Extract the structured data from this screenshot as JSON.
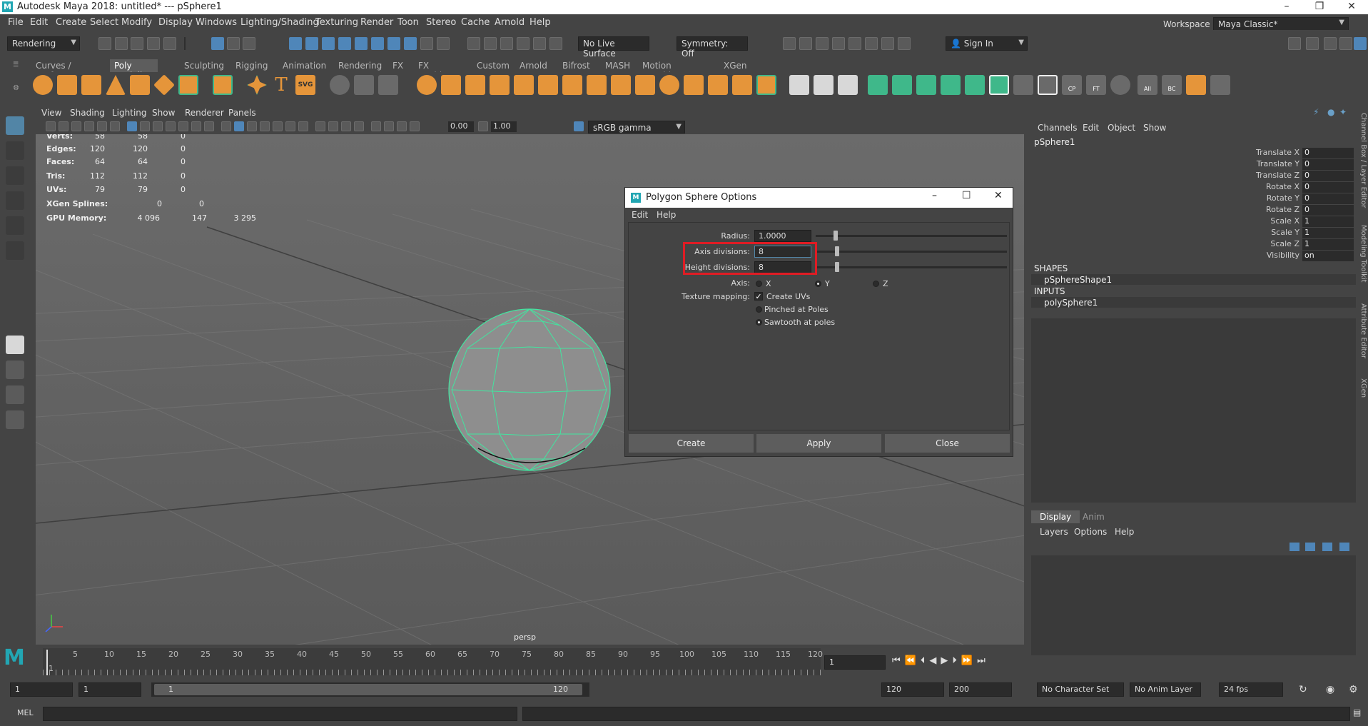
{
  "window": {
    "title": "Autodesk Maya 2018: untitled*   ---   pSphere1",
    "minimize": "–",
    "restore": "❐",
    "close": "✕"
  },
  "menubar": {
    "items": [
      "File",
      "Edit",
      "Create",
      "Select",
      "Modify",
      "Display",
      "Windows",
      "Lighting/Shading",
      "Texturing",
      "Render",
      "Toon",
      "Stereo",
      "Cache",
      "Arnold",
      "Help"
    ],
    "workspace_label": "Workspace :",
    "workspace_value": "Maya Classic*"
  },
  "statusline": {
    "menuset": "Rendering",
    "live_surface": "No Live Surface",
    "symmetry": "Symmetry: Off",
    "sign_in": "Sign In"
  },
  "shelf": {
    "tabs": [
      "Curves / Surfaces",
      "Poly Modeling",
      "Sculpting",
      "Rigging",
      "Animation",
      "Rendering",
      "FX",
      "FX Caching",
      "Custom",
      "Arnold",
      "Bifrost",
      "MASH",
      "Motion Graphics",
      "XGen"
    ],
    "active_tab": "Poly Modeling",
    "icon_labels": {
      "cp": "CP",
      "ft": "FT",
      "all": "All",
      "bc": "BC",
      "text": "T",
      "svg": "SVG"
    }
  },
  "viewport": {
    "menu": [
      "View",
      "Shading",
      "Lighting",
      "Show",
      "Renderer",
      "Panels"
    ],
    "exposure": "0.00",
    "gamma_value": "1.00",
    "color_space": "sRGB gamma",
    "camera": "persp",
    "hud": [
      {
        "label": "Verts:",
        "v1": "58",
        "v2": "58",
        "v3": "0"
      },
      {
        "label": "Edges:",
        "v1": "120",
        "v2": "120",
        "v3": "0"
      },
      {
        "label": "Faces:",
        "v1": "64",
        "v2": "64",
        "v3": "0"
      },
      {
        "label": "Tris:",
        "v1": "112",
        "v2": "112",
        "v3": "0"
      },
      {
        "label": "UVs:",
        "v1": "79",
        "v2": "79",
        "v3": "0"
      },
      {
        "label": "XGen Splines:",
        "v1": "0",
        "v2": "0",
        "v3": ""
      },
      {
        "label": "GPU Memory:",
        "v1": "4 096",
        "v2": "147",
        "v3": "3 295"
      }
    ]
  },
  "dialog": {
    "title": "Polygon Sphere Options",
    "menu": [
      "Edit",
      "Help"
    ],
    "radius_label": "Radius:",
    "radius_value": "1.0000",
    "axis_div_label": "Axis divisions:",
    "axis_div_value": "8",
    "height_div_label": "Height divisions:",
    "height_div_value": "8",
    "axis_label": "Axis:",
    "axis_options": [
      "X",
      "Y",
      "Z"
    ],
    "axis_selected": "Y",
    "texture_label": "Texture mapping:",
    "create_uvs": "Create UVs",
    "pinched": "Pinched at Poles",
    "sawtooth": "Sawtooth at poles",
    "buttons": [
      "Create",
      "Apply",
      "Close"
    ]
  },
  "channel_box": {
    "menu": [
      "Channels",
      "Edit",
      "Object",
      "Show"
    ],
    "object": "pSphere1",
    "attributes": [
      {
        "name": "Translate X",
        "value": "0"
      },
      {
        "name": "Translate Y",
        "value": "0"
      },
      {
        "name": "Translate Z",
        "value": "0"
      },
      {
        "name": "Rotate X",
        "value": "0"
      },
      {
        "name": "Rotate Y",
        "value": "0"
      },
      {
        "name": "Rotate Z",
        "value": "0"
      },
      {
        "name": "Scale X",
        "value": "1"
      },
      {
        "name": "Scale Y",
        "value": "1"
      },
      {
        "name": "Scale Z",
        "value": "1"
      },
      {
        "name": "Visibility",
        "value": "on"
      }
    ],
    "shapes_header": "SHAPES",
    "shape": "pSphereShape1",
    "inputs_header": "INPUTS",
    "input": "polySphere1"
  },
  "layer_editor": {
    "tabs": [
      "Display",
      "Anim"
    ],
    "menu": [
      "Layers",
      "Options",
      "Help"
    ]
  },
  "side_tabs": [
    "Channel Box / Layer Editor",
    "Modeling Toolkit",
    "Attribute Editor",
    "XGen"
  ],
  "timeline": {
    "tick_labels": [
      "5",
      "10",
      "15",
      "20",
      "25",
      "30",
      "35",
      "40",
      "45",
      "50",
      "55",
      "60",
      "65",
      "70",
      "75",
      "80",
      "85",
      "90",
      "95",
      "100",
      "105",
      "110",
      "115",
      "120"
    ],
    "start_label": "1",
    "current_frame": "1"
  },
  "range": {
    "start": "1",
    "playback_start": "1",
    "range_start": "1",
    "range_end": "120",
    "playback_end": "120",
    "end": "200",
    "character_set": "No Character Set",
    "anim_layer": "No Anim Layer",
    "fps": "24 fps"
  },
  "command_line": {
    "label": "MEL"
  },
  "colors": {
    "accent": "#5285a6",
    "wireframe": "#41e6a0",
    "highlight_box": "#e01c24"
  }
}
